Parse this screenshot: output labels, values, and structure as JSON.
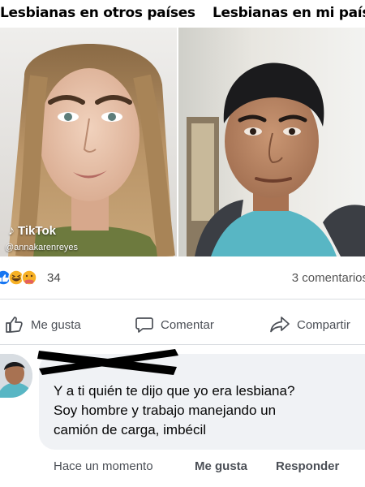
{
  "meme": {
    "caption_left": "Lesbianas en otros países",
    "caption_right": "Lesbianas en mi país",
    "watermark_brand": "TikTok",
    "watermark_handle": "@annakarenreyes"
  },
  "post_stats": {
    "reaction_icons": [
      "like-icon",
      "haha-icon",
      "care-icon"
    ],
    "reaction_count": "34",
    "comments_count": "3 comentarios"
  },
  "actions": {
    "like_label": "Me gusta",
    "comment_label": "Comentar",
    "share_label": "Compartir"
  },
  "comment": {
    "lines": [
      "Y a ti quién te dijo que yo era lesbiana?",
      "Soy hombre y trabajo manejando un",
      "camión de carga, imbécil"
    ],
    "time": "Hace un momento",
    "like_label": "Me gusta",
    "reply_label": "Responder"
  },
  "colors": {
    "facebook_blue": "#1877f2",
    "bubble_bg": "#f0f2f5",
    "meta_text": "#4b4f56",
    "divider": "#dadde1"
  }
}
